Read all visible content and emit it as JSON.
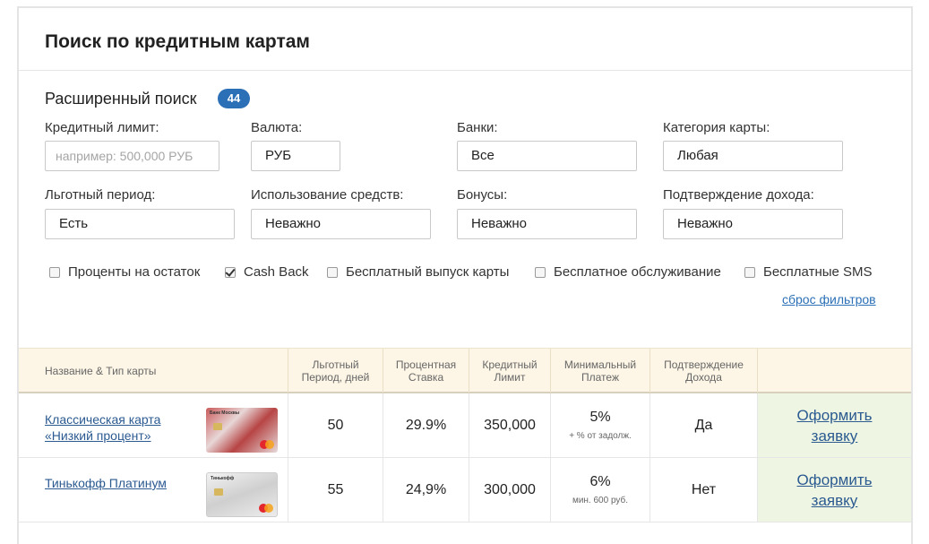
{
  "page": {
    "title": "Поиск по кредитным картам"
  },
  "search": {
    "advanced_label": "Расширенный поиск",
    "count": "44",
    "filters": [
      {
        "label": "Кредитный лимит:",
        "value": "",
        "placeholder": "например: 500,000 РУБ"
      },
      {
        "label": "Валюта:",
        "value": "РУБ"
      },
      {
        "label": "Банки:",
        "value": "Все"
      },
      {
        "label": "Категория карты:",
        "value": "Любая"
      },
      {
        "label": "Льготный период:",
        "value": "Есть"
      },
      {
        "label": "Использование средств:",
        "value": "Неважно"
      },
      {
        "label": "Бонусы:",
        "value": "Неважно"
      },
      {
        "label": "Подтверждение дохода:",
        "value": "Неважно"
      }
    ],
    "checkboxes": [
      {
        "label": "Проценты на остаток",
        "checked": false
      },
      {
        "label": "Cash Back",
        "checked": true
      },
      {
        "label": "Бесплатный выпуск карты",
        "checked": false
      },
      {
        "label": "Бесплатное обслуживание",
        "checked": false
      },
      {
        "label": "Бесплатные SMS",
        "checked": false
      }
    ],
    "reset_label": "сброс фильтров"
  },
  "table": {
    "headers": {
      "name": "Название & Тип карты",
      "grace_1": "Льготный",
      "grace_2": "Период, дней",
      "rate_1": "Процентная",
      "rate_2": "Ставка",
      "limit_1": "Кредитный",
      "limit_2": "Лимит",
      "min_1": "Минимальный",
      "min_2": "Платеж",
      "proof_1": "Подтверждение",
      "proof_2": "Дохода"
    },
    "rows": [
      {
        "name_1": "Классическая карта",
        "name_2": "«Низкий процент»",
        "card_brand": "Банк Москвы",
        "grace": "50",
        "rate": "29.9%",
        "limit": "350,000",
        "min": "5%",
        "min_note": "+ % от задолж.",
        "proof": "Да",
        "apply_1": "Оформить",
        "apply_2": "заявку"
      },
      {
        "name_1": "Тинькофф Платинум",
        "name_2": "",
        "card_brand": "Тинькофф",
        "grace": "55",
        "rate": "24,9%",
        "limit": "300,000",
        "min": "6%",
        "min_note": "мин. 600 руб.",
        "proof": "Нет",
        "apply_1": "Оформить",
        "apply_2": "заявку"
      }
    ]
  }
}
